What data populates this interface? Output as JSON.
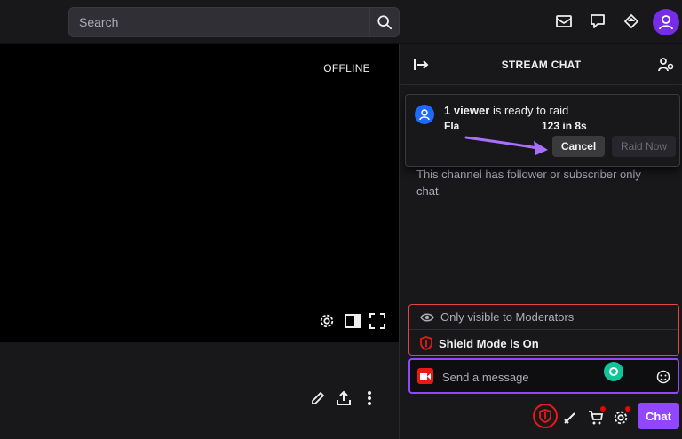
{
  "search": {
    "placeholder": "Search",
    "icon": "search-icon"
  },
  "topbar_icons": [
    "inbox-icon",
    "whispers-icon",
    "prime-loot-icon",
    "user-avatar-icon"
  ],
  "player": {
    "status": "OFFLINE",
    "controls": [
      "settings-icon",
      "theatre-mode-icon",
      "fullscreen-icon"
    ]
  },
  "below_player": {
    "icons": [
      "edit-icon",
      "share-icon",
      "more-vertical-icon"
    ]
  },
  "chat": {
    "title": "STREAM CHAT",
    "collapse_icon": "collapse-arrow-icon",
    "users_icon": "community-icon",
    "raid": {
      "viewer_count_label": "1 viewer",
      "message": " is ready to raid",
      "target_name": "Fla",
      "countdown": "123 in 8s",
      "cancel_label": "Cancel",
      "raid_now_label": "Raid Now"
    },
    "notice": "This channel has follower or subscriber only chat.",
    "mod_box": {
      "visibility_text": "Only visible to Moderators",
      "shield_text": "Shield Mode is On"
    },
    "input": {
      "placeholder": "Send a message"
    },
    "chat_button_label": "Chat"
  },
  "colors": {
    "accent": "#9147ff",
    "danger": "#e91916",
    "background": "#18181b",
    "player_bg": "#000000",
    "annotation_arrow": "#a970ff"
  }
}
